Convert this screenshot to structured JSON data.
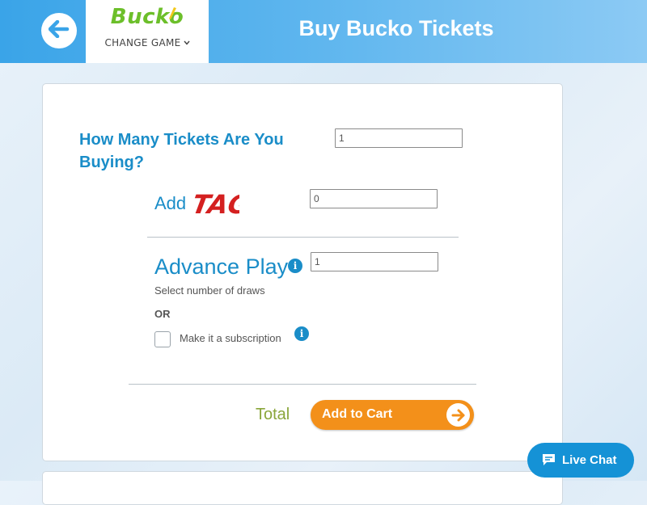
{
  "header": {
    "page_title": "Buy Bucko Tickets",
    "game_logo": "Bucko",
    "change_game_label": "CHANGE GAME",
    "back_icon": "arrow-left-icon"
  },
  "form": {
    "question": "How Many Tickets Are You Buying?",
    "tickets_value": "1",
    "add_label": "Add",
    "tag_logo": "TAG",
    "tag_value": "0",
    "advance_play_label": "Advance Play",
    "advance_play_value": "1",
    "select_draws_text": "Select number of draws",
    "or_text": "OR",
    "subscription_label": "Make it a subscription",
    "subscription_checked": false,
    "total_label": "Total",
    "add_to_cart_label": "Add to Cart"
  },
  "live_chat": {
    "label": "Live Chat"
  },
  "colors": {
    "accent_blue": "#1a8dc8",
    "header_blue": "#3aa4e8",
    "cart_orange": "#f3901a",
    "total_green": "#8aa63a",
    "logo_green": "#6cbf2a",
    "tag_red": "#d42020"
  }
}
